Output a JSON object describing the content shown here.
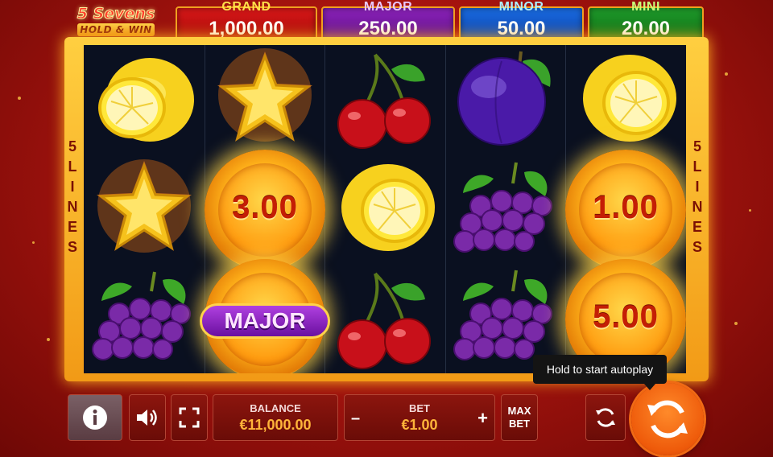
{
  "logo": {
    "line1": "5 Sevens",
    "line2": "HOLD & WIN"
  },
  "jackpots": {
    "grand": {
      "label": "GRAND",
      "value": "1,000.00"
    },
    "major": {
      "label": "MAJOR",
      "value": "250.00"
    },
    "minor": {
      "label": "MINOR",
      "value": "50.00"
    },
    "mini": {
      "label": "MINI",
      "value": "20.00"
    }
  },
  "lines": {
    "count": "5",
    "word": "LINES"
  },
  "reels": [
    [
      "lemon",
      "star",
      "grapes"
    ],
    [
      "star",
      "coin",
      "coin-major"
    ],
    [
      "cherry",
      "lemon",
      "cherry"
    ],
    [
      "plum",
      "grapes",
      "grapes"
    ],
    [
      "lemon",
      "coin",
      "coin"
    ]
  ],
  "coins": {
    "reel2_row2": "3.00",
    "reel2_row3": "MAJOR",
    "reel5_row2": "1.00",
    "reel5_row3": "5.00"
  },
  "controls": {
    "info_icon": "info-icon",
    "sound_icon": "speaker-icon",
    "fullscreen_icon": "fullscreen-icon",
    "balance_label": "BALANCE",
    "balance_value": "€11,000.00",
    "bet_label": "BET",
    "bet_value": "€1.00",
    "bet_minus": "–",
    "bet_plus": "+",
    "max_bet_line1": "MAX",
    "max_bet_line2": "BET",
    "autoplay_icon": "autoplay-icon",
    "spin_icon": "spin-icon"
  },
  "tooltip": "Hold to start autoplay",
  "colors": {
    "background": "#c01a12",
    "frame": "#f8b82a",
    "grand": "#c81212",
    "major": "#7a1aa8",
    "minor": "#1458c8",
    "mini": "#168a22",
    "spin": "#f06a14"
  }
}
